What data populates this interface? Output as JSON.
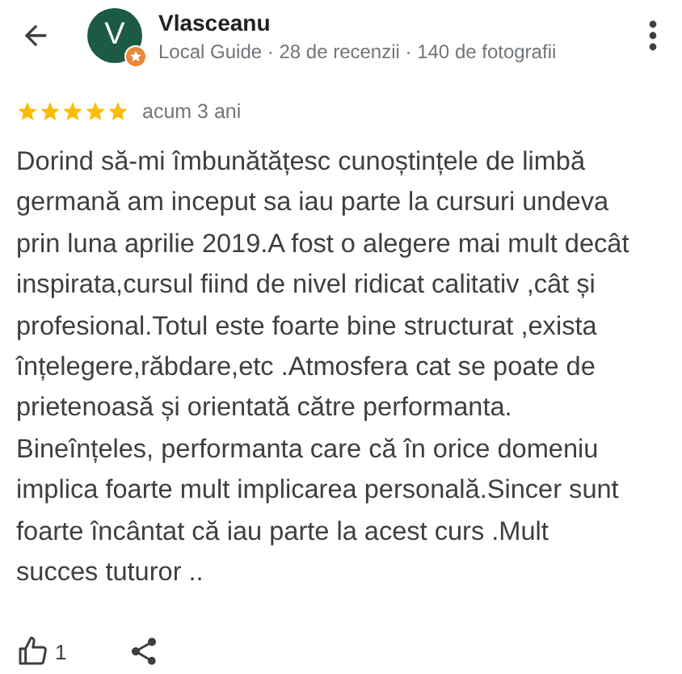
{
  "header": {
    "name": "Vlasceanu",
    "avatar_letter": "V",
    "subtitle": "Local Guide · 28 de recenzii · 140 de fotografii"
  },
  "rating": {
    "stars": 5,
    "time": "acum 3 ani"
  },
  "review_lines": [
    "Dorind să-mi îmbunătățesc cunoștințele de limbă",
    "germană am inceput sa iau parte la cursuri undeva",
    "prin luna aprilie 2019.A fost o alegere mai mult decât",
    "inspirata,cursul fiind de nivel ridicat calitativ ,cât și",
    "profesional.Totul este foarte bine structurat ,exista",
    "înțelegere,răbdare,etc .Atmosfera cat se poate de",
    "prietenoasă și orientată către performanta.",
    "Bineînțeles, performanta care că în orice domeniu",
    "implica foarte mult implicarea personală.Sincer sunt",
    "foarte încântat că iau parte la acest curs .Mult",
    "succes tuturor .."
  ],
  "actions": {
    "like_count": "1"
  }
}
